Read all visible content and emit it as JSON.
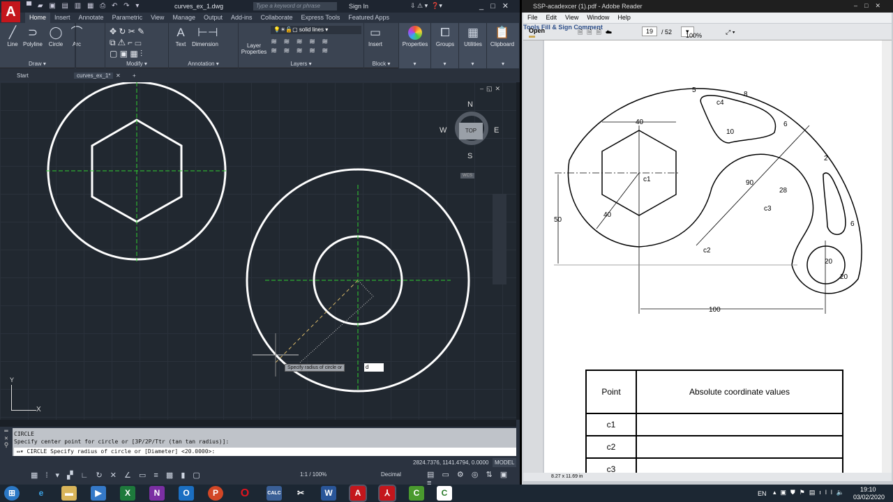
{
  "autocad": {
    "title": "curves_ex_1.dwg",
    "search_placeholder": "Type a keyword or phrase",
    "sign_in": "Sign In",
    "tabs": [
      "Home",
      "Insert",
      "Annotate",
      "Parametric",
      "View",
      "Manage",
      "Output",
      "Add-ins",
      "Collaborate",
      "Express Tools",
      "Featured Apps"
    ],
    "draw_tools": [
      "Line",
      "Polyline",
      "Circle",
      "Arc"
    ],
    "draw_panel": "Draw",
    "modify_panel": "Modify",
    "annotation_tools": [
      "Text",
      "Dimension"
    ],
    "annotation_panel": "Annotation",
    "layer_props": "Layer Properties",
    "layer_name": "solid lines",
    "layers_panel": "Layers",
    "insert": "Insert",
    "block_panel": "Block",
    "properties": "Properties",
    "groups": "Groups",
    "utilities": "Utilities",
    "clipboard": "Clipboard",
    "doc_tabs": [
      "Start",
      "curves_ex_1*"
    ],
    "viewcube": {
      "n": "N",
      "s": "S",
      "e": "E",
      "w": "W",
      "top": "TOP",
      "wcs": "WCS"
    },
    "tooltip": "Specify radius of circle or",
    "tooltip_input": "d",
    "ucs": {
      "x": "X",
      "y": "Y"
    },
    "command_history": [
      "CIRCLE",
      "Specify center point for circle or [3P/2P/Ttr (tan tan radius)]:"
    ],
    "command_line": "CIRCLE Specify radius of circle or [Diameter] <20.0000>:",
    "coords": "2824.7376, 1141.4794, 0.0000",
    "model": "MODEL",
    "scale": "1:1 / 100%",
    "units": "Decimal",
    "colors": {
      "accent": "#c4161c",
      "viewport": "#212830"
    }
  },
  "pdf": {
    "title": "SSP-acadexcer (1).pdf - Adobe Reader",
    "menu": [
      "File",
      "Edit",
      "View",
      "Window",
      "Help"
    ],
    "open": "Open",
    "page": "19",
    "page_total": "/ 52",
    "zoom": "100%",
    "tools": "Tools",
    "fill_sign": "Fill & Sign",
    "comment": "Comment",
    "drawing_labels": {
      "d40": "40",
      "d50": "50",
      "d100": "100",
      "r40": "40",
      "r90": "90",
      "r28": "28",
      "r5": "5",
      "r6a": "6",
      "r6b": "6",
      "r10": "10",
      "r2": "2",
      "r20": "20",
      "d20": "20",
      "e8": "8",
      "c1": "c1",
      "c2": "c2",
      "c3": "c3",
      "c4": "c4"
    },
    "table": {
      "header": [
        "Point",
        "Absolute coordinate values"
      ],
      "rows": [
        "c1",
        "c2",
        "c3"
      ]
    },
    "page_size": "8.27 x 11.69 in"
  },
  "taskbar": {
    "lang": "EN",
    "time": "19:10",
    "date": "03/02/2020"
  }
}
